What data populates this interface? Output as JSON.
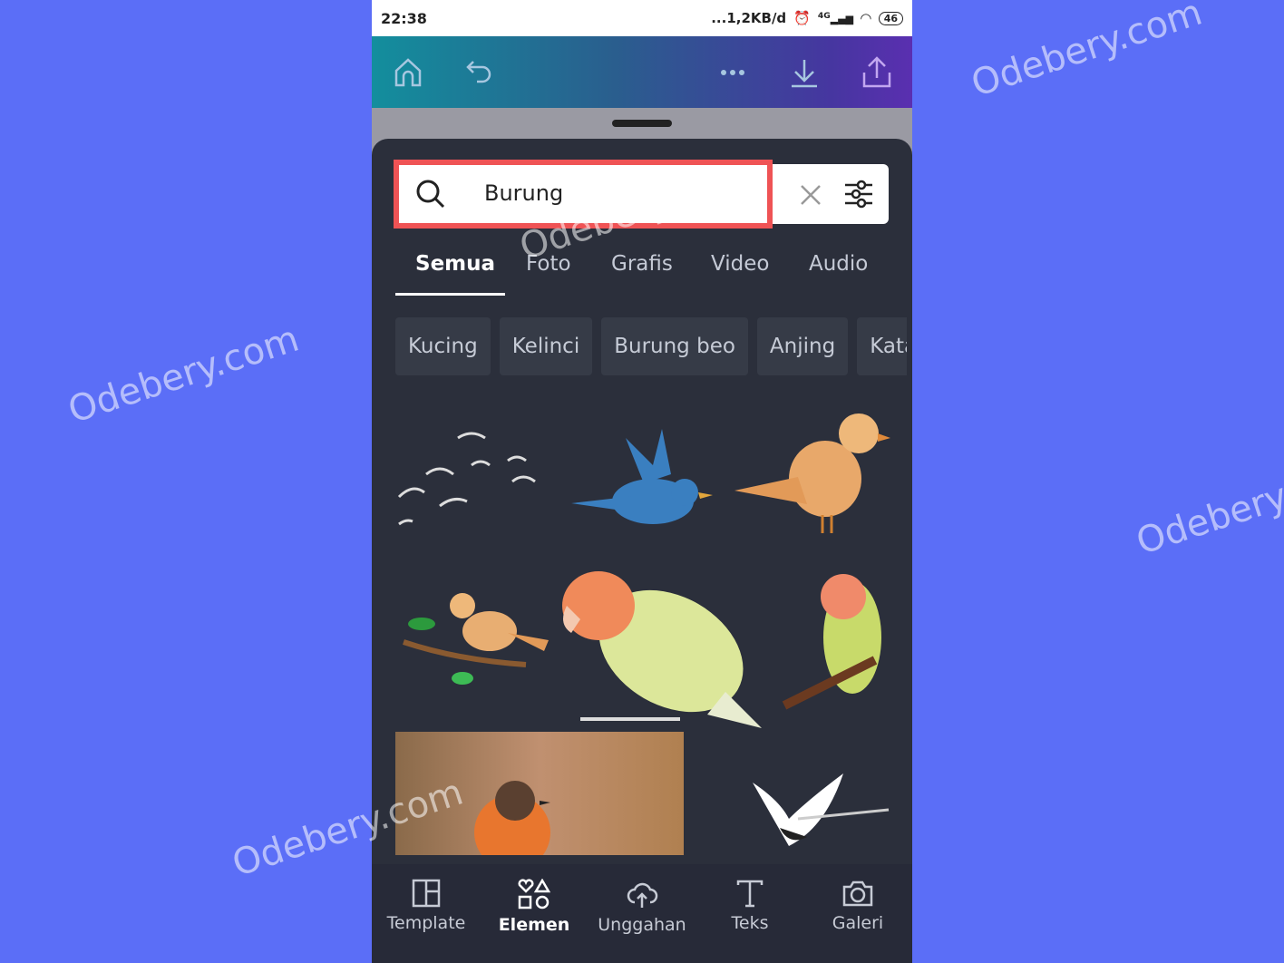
{
  "status": {
    "time": "22:38",
    "network_speed": "...1,2KB/d",
    "network": "4G",
    "battery": "46"
  },
  "toolbar": {
    "icons": [
      "home-icon",
      "undo-icon",
      "more-icon",
      "download-icon",
      "share-icon"
    ]
  },
  "search": {
    "query": "Burung",
    "highlight_color": "#ef5355"
  },
  "tabs": [
    {
      "label": "Semua",
      "active": true
    },
    {
      "label": "Foto"
    },
    {
      "label": "Grafis"
    },
    {
      "label": "Video"
    },
    {
      "label": "Audio"
    }
  ],
  "chips": [
    "Kucing",
    "Kelinci",
    "Burung beo",
    "Anjing",
    "Katak"
  ],
  "results": [
    "flock-of-gulls",
    "blue-bird",
    "orange-bird",
    "bird-on-branch",
    "lovebird-large",
    "lovebird-perched",
    "robin-photo",
    "crane"
  ],
  "bottom_nav": [
    {
      "label": "Template"
    },
    {
      "label": "Elemen",
      "active": true
    },
    {
      "label": "Unggahan"
    },
    {
      "label": "Teks"
    },
    {
      "label": "Galeri"
    }
  ],
  "watermarks": [
    "Odebery.com",
    "Odebery.com",
    "Odebery",
    "Odebery",
    "Odebery.com"
  ],
  "colors": {
    "background": "#5b6ef7",
    "panel": "#2b2f3b"
  }
}
